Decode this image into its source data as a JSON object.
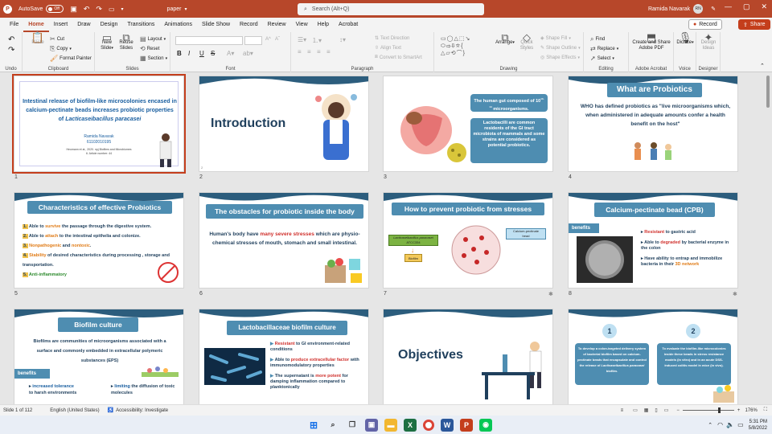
{
  "titlebar": {
    "autosave_label": "AutoSave",
    "autosave_state": "Off",
    "doc_name": "paper",
    "search_placeholder": "Search (Alt+Q)",
    "user_name": "Ramida Navarak",
    "user_initials": "RN"
  },
  "menu": {
    "items": [
      "File",
      "Home",
      "Insert",
      "Draw",
      "Design",
      "Transitions",
      "Animations",
      "Slide Show",
      "Record",
      "Review",
      "View",
      "Help",
      "Acrobat"
    ],
    "active": "Home",
    "record_label": "Record",
    "share_label": "Share"
  },
  "ribbon": {
    "undo": {
      "label": "Undo"
    },
    "clipboard": {
      "paste": "Paste",
      "cut": "Cut",
      "copy": "Copy",
      "format_painter": "Format Painter",
      "label": "Clipboard"
    },
    "slides": {
      "new_slide": "New",
      "new_slide2": "Slide",
      "reuse": "Reuse",
      "reuse2": "Slides",
      "layout": "Layout",
      "reset": "Reset",
      "section": "Section",
      "label": "Slides"
    },
    "font": {
      "label": "Font",
      "bold": "B",
      "italic": "I",
      "underline": "U",
      "strike": "S"
    },
    "paragraph": {
      "label": "Paragraph",
      "text_direction": "Text Direction",
      "align_text": "Align Text",
      "smartart": "Convert to SmartArt"
    },
    "drawing": {
      "arrange": "Arrange",
      "quick_styles": "Quick",
      "quick_styles2": "Styles",
      "fill": "Shape Fill",
      "outline": "Shape Outline",
      "effects": "Shape Effects",
      "label": "Drawing"
    },
    "editing": {
      "find": "Find",
      "replace": "Replace",
      "select": "Select",
      "label": "Editing"
    },
    "acrobat": {
      "create": "Create and Share",
      "create2": "Adobe PDF",
      "label": "Adobe Acrobat"
    },
    "voice": {
      "dictate": "Dictate",
      "label": "Voice"
    },
    "designer": {
      "ideas": "Design",
      "ideas2": "Ideas",
      "label": "Designer"
    }
  },
  "slides": [
    {
      "num": "1",
      "title": "Intestinal release of biofilm-like microcolonies encased in calcium-pectinate beads increases probiotic properties of",
      "title_italic": "Lacticaseibacillus paracasei",
      "author": "Ramida Navarak",
      "id": "61102010195",
      "citation": "Heumann et al., 2020. npj Biofilms and Microbiomes",
      "article": "6. Article number: 44"
    },
    {
      "num": "2",
      "title": "Introduction"
    },
    {
      "num": "3",
      "box1": "The human gut composed of 10",
      "box1_sup": "13-14",
      "box1_end": " microorganisms.",
      "box2": "Lactobacilli are common residents of the GI tract microbiota of mammals and some strains are considered as potential probiotics."
    },
    {
      "num": "4",
      "title": "What are Probiotics",
      "body": "WHO has defined probiotics as \"live microorganisms which, when administered in adequate amounts confer a health benefit on the host\""
    },
    {
      "num": "5",
      "title": "Characteristics of effective Probiotics",
      "items": [
        {
          "n": "1.",
          "pre": "Able to ",
          "hl": "survive",
          "post": " the passage through the digestive system."
        },
        {
          "n": "2.",
          "pre": "Able to ",
          "hl": "attach",
          "post": " to the intestinal epithelia and colonize."
        },
        {
          "n": "3.",
          "pre": "",
          "hl": "Nonpathogenic",
          "post": " and ",
          "hl2": "nontoxic",
          "post2": "."
        },
        {
          "n": "4.",
          "pre": "",
          "hl": "Stability",
          "post": " of desired characteristics during processing , storage and transportation."
        },
        {
          "n": "5.",
          "pre": "",
          "hl": "Anti-inflammatory",
          "post": ""
        }
      ]
    },
    {
      "num": "6",
      "title": "The obstacles for probiotic inside the body",
      "body_pre": "Human's body have ",
      "body_hl": "many severe stresses",
      "body_post": " which are physio-chemical stresses of mouth, stomach and small intestinal."
    },
    {
      "num": "7",
      "title": "How to prevent probiotic from stresses",
      "label1": "Lacticaseibacillus paracasei",
      "label1b": "ATCC334",
      "label2": "Biofilm",
      "label3": "Calcium-pectinate",
      "label3b": "bead"
    },
    {
      "num": "8",
      "title": "Calcium-pectinate bead (CPB)",
      "benefits": "benefits",
      "b1_hl": "Resistant",
      "b1": " to gastric acid",
      "b2_pre": "Able to ",
      "b2_hl": "degraded",
      "b2_post": " by bacterial enzyme in the colon",
      "b3": "Have ability to entrap and immobilize bacteria in their ",
      "b3_hl": "3D network"
    },
    {
      "num": "9",
      "title": "Biofilm culture",
      "body": "Biofilms are communities of microorganisms associated with a surface and commonly embedded in extracellular polymeric substances (EPS)",
      "benefits": "benefits",
      "b1_hl": "increased tolerance",
      "b1": "to harsh environments",
      "b2_hl": "limiting",
      "b2": " the diffusion of toxic molecules"
    },
    {
      "num": "10",
      "title": "Lactobacillaceae biofilm culture",
      "i1_hl": "Resistant",
      "i1": " to GI environment-related conditions",
      "i2_pre": "Able to ",
      "i2_hl": "produce extracellular factor",
      "i2_post": " with immunomodulatory properties",
      "i3_pre": "The supernatant is ",
      "i3_hl": "more potent",
      "i3_post": " for damping inflammation compared to planktonically"
    },
    {
      "num": "11",
      "title": "Objectives"
    },
    {
      "num": "12",
      "n1": "1",
      "n2": "2",
      "o1": "To develop a colon-targeted delivery system of bacterial biofilm based on calcium-pectinate beads that encapsulate and control the release of ",
      "o1_it": "Lacticaseibacillus paracasei",
      "o1_end": " biofilm.",
      "o2": "To evaluate the biofilm-like microcolonies inside these beads in stress resistance models (in vitro) and in an acute DSS-induced colitis model in mice (in vivo)."
    }
  ],
  "status": {
    "slide_info": "Slide 1 of 112",
    "language": "English (United States)",
    "accessibility": "Accessibility: Investigate",
    "zoom": "176%"
  },
  "taskbar": {
    "time": "5:31 PM",
    "date": "5/8/2022"
  }
}
